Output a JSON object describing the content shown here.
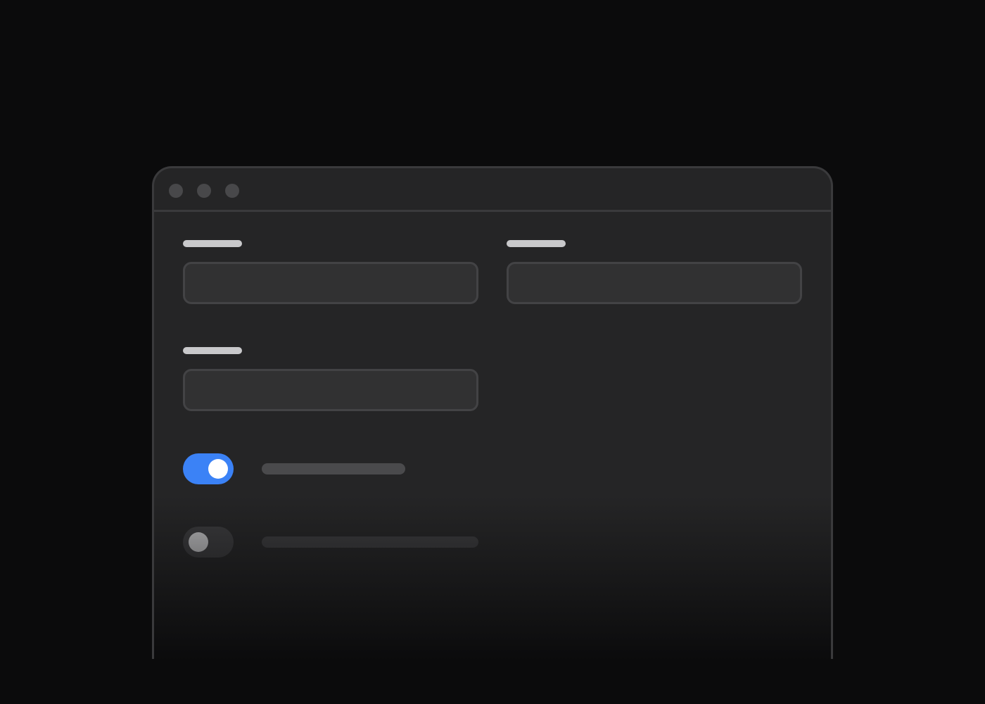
{
  "colors": {
    "background": "#0b0b0c",
    "window": "#252526",
    "window_border": "#3a3a3c",
    "traffic_light": "#48484a",
    "label_placeholder": "#c9c9cb",
    "field_bg": "#313132",
    "field_border": "#434345",
    "toggle_on_track": "#3b82f6",
    "toggle_on_knob": "#ffffff",
    "toggle_off_track": "#3a3a3c",
    "toggle_off_knob": "#b9b9bb",
    "desc_placeholder": "#4a4a4c",
    "desc_placeholder_dim": "#3a3a3c"
  },
  "window": {
    "traffic_lights": [
      "close",
      "minimize",
      "zoom"
    ]
  },
  "form": {
    "fields": [
      {
        "id": "field-1",
        "label": "",
        "value": "",
        "placeholder": ""
      },
      {
        "id": "field-2",
        "label": "",
        "value": "",
        "placeholder": ""
      },
      {
        "id": "field-3",
        "label": "",
        "value": "",
        "placeholder": ""
      }
    ],
    "toggles": [
      {
        "id": "toggle-1",
        "state": "on",
        "label": ""
      },
      {
        "id": "toggle-2",
        "state": "off",
        "label": ""
      }
    ]
  }
}
